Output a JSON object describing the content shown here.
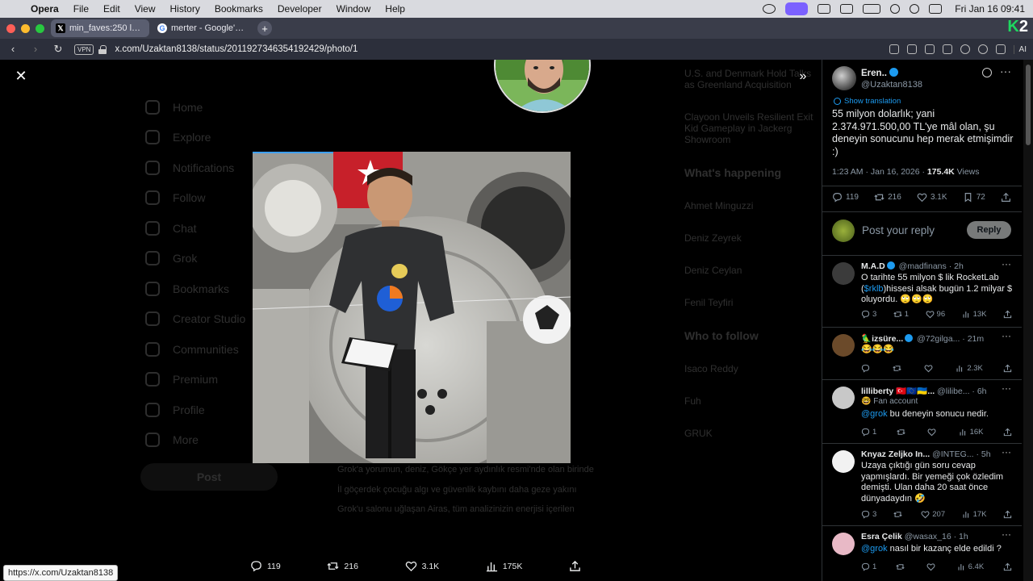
{
  "menubar": {
    "app_name": "Opera",
    "items": [
      "File",
      "Edit",
      "View",
      "History",
      "Bookmarks",
      "Developer",
      "Window",
      "Help"
    ],
    "clock": "Fri Jan 16  09:41"
  },
  "tabs": [
    {
      "label": "min_faves:250 lang:tr -f",
      "favicon": "x-icon",
      "active": true
    },
    {
      "label": "merter - Google'da Ara",
      "favicon": "google-icon",
      "active": false
    }
  ],
  "address": {
    "vpn_label": "VPN",
    "url": "x.com/Uzaktan8138/status/2011927346354192429/photo/1",
    "ai_label": "AI"
  },
  "background_page": {
    "nav": [
      "Home",
      "Explore",
      "Notifications",
      "Follow",
      "Chat",
      "Grok",
      "Bookmarks",
      "Creator Studio",
      "Communities",
      "Premium",
      "Profile",
      "More"
    ],
    "post_button": "Post",
    "right_column": [
      "U.S. and Denmark Hold Talks as Greenland Acquisition",
      "Clayoon Unveils Resilient Exit Kid Gameplay in Jackerg Showroom",
      "What's happening",
      "Ahmet Minguzzi",
      "Deniz Zeyrek",
      "Deniz Ceylan",
      "Fenil Teyfiri",
      "Who to follow",
      "Isaco Reddy",
      "Fuh",
      "GRUK"
    ],
    "center_text": [
      "Grok'a yorumun, deniz, Gökçe yer aydınlık resmi'nde olan birinde",
      "İl göçerdek çocuğu algı ve güvenlik kaybını daha geze yakını",
      "Grok'u salonu uğlaşan Airas, tüm analizinizin enerjisi içerilen"
    ]
  },
  "action_bar": {
    "replies": "119",
    "reposts": "216",
    "likes": "3.1K",
    "views": "175K"
  },
  "status_link": "https://x.com/Uzaktan8138",
  "tweet": {
    "author_name": "Eren..",
    "author_handle": "@Uzaktan8138",
    "show_translation": "Show translation",
    "text": "55 milyon dolarlık; yani 2.374.971.500,00 TL'ye mâl olan, şu deneyin sonucunu hep merak etmişimdir :)",
    "timestamp": "1:23 AM · Jan 16, 2026 · ",
    "views_count": "175.4K",
    "views_label": " Views",
    "replies": "119",
    "reposts": "216",
    "likes": "3.1K",
    "bookmarks": "72"
  },
  "compose": {
    "placeholder": "Post your reply",
    "button": "Reply"
  },
  "replies": [
    {
      "name": "M.A.D",
      "verified": true,
      "handle": "@madfinans · 2h",
      "sub": "",
      "text_pre": "O tarihte 55 milyon $ lik RocketLab  (",
      "mention": "$rklb",
      "text_post": ")hissesi alsak bugün 1.2 milyar $ oluyordu. 🙄🙄🙄",
      "replies": "3",
      "reposts": "1",
      "likes": "96",
      "views": "13K",
      "avatar_color": "#3b3b3b"
    },
    {
      "name": "🦜izsüre...",
      "verified": true,
      "handle": "@72gilga... · 21m",
      "sub": "",
      "text_pre": "😂😂😂",
      "mention": "",
      "text_post": "",
      "replies": "",
      "reposts": "",
      "likes": "",
      "views": "2.3K",
      "avatar_color": "#6b4a2a"
    },
    {
      "name": "lilliberty 🇹🇷🇪🇺🇺🇦...",
      "verified": false,
      "handle": "@lilibe... · 6h",
      "sub": "🤓 Fan account",
      "text_pre": "",
      "mention": "@grok",
      "text_post": " bu deneyin sonucu nedir.",
      "replies": "1",
      "reposts": "",
      "likes": "",
      "views": "16K",
      "avatar_color": "#c8c8c8"
    },
    {
      "name": "Knyaz Zeljko In...",
      "verified": false,
      "handle": "@INTEG... · 5h",
      "sub": "",
      "text_pre": "Uzaya çıktığı gün soru cevap yapmışlardı. Bir yemeği çok özledim demişti. Ulan daha 20 saat önce dünyadaydın 🤣",
      "mention": "",
      "text_post": "",
      "replies": "3",
      "reposts": "",
      "likes": "207",
      "views": "17K",
      "avatar_color": "#f2f2f2"
    },
    {
      "name": "Esra Çelik",
      "verified": false,
      "handle": "@wasax_16 · 1h",
      "sub": "",
      "text_pre": "",
      "mention": "@grok",
      "text_post": " nasıl bir kazanç elde edildi ?",
      "replies": "1",
      "reposts": "",
      "likes": "",
      "views": "6.4K",
      "avatar_color": "#e8b9c6"
    }
  ]
}
